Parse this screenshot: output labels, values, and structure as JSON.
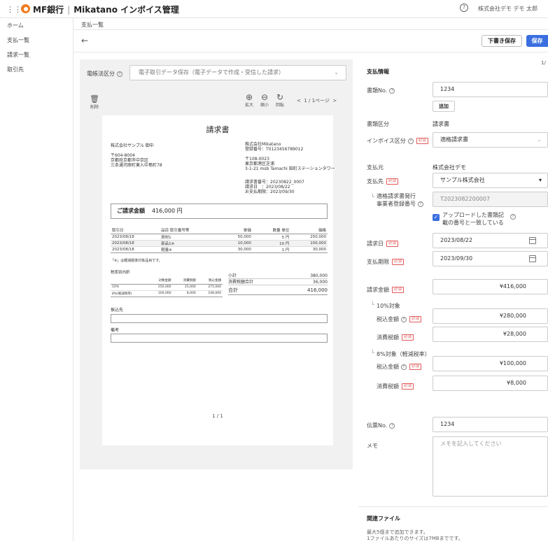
{
  "header": {
    "brand_bank": "MF銀行",
    "brand_app": "Mikatano インボイス管理",
    "help_icon_glyph": "?",
    "company_user": "株式会社デモ デモ 太郎",
    "accent_color": "#3b6fe0",
    "logo_color": "#ef7d22"
  },
  "sidebar": {
    "items": [
      {
        "label": "ホーム"
      },
      {
        "label": "支払一覧"
      },
      {
        "label": "請求一覧"
      },
      {
        "label": "取引先"
      }
    ]
  },
  "breadcrumb": "支払一覧",
  "toolbar": {
    "back_glyph": "←",
    "draft_label": "下書き保存",
    "save_label": "保存",
    "page_counter": "1/"
  },
  "viewer": {
    "law_label": "電帳法区分",
    "law_value": "電子取引データ保存（電子データで作成・受信した請求）",
    "delete_label": "削除",
    "zoom_in_label": "拡大",
    "zoom_out_label": "縮小",
    "rotate_label": "回転",
    "pager_text": "1 / 1ページ",
    "page_footer": "1 / 1"
  },
  "invoice_doc": {
    "title": "請求書",
    "to_company": "株式会社サンプル 御中",
    "to_postal": "〒604-8004",
    "to_addr1": "京都府京都市中京区",
    "to_addr2": "三条通河原町東入中島町78",
    "from_company": "株式会社Mikatano",
    "from_regno": "登録番号：T0123456789012",
    "from_postal": "〒108-0023",
    "from_addr1": "東京都港区芝浦",
    "from_addr2": "3-1-21 msb Tamachi 田町ステーションタワー",
    "meta1": "請求書番号：20230822_0007",
    "meta2": "請求日　：2023/08/22",
    "meta3": "お支払期限：2023/09/30",
    "total_label": "ご請求金額",
    "total_value": "416,000 円",
    "head": [
      "取引日",
      "品目 取引番号等",
      "単価",
      "数量 単位",
      "価格"
    ],
    "rows": [
      [
        "2023/08/18",
        "資材1",
        "50,000",
        "5 円",
        "250,000"
      ],
      [
        "2023/08/18",
        "部品1※",
        "10,000",
        "10 円",
        "100,000"
      ],
      [
        "2023/08/18",
        "軽量※",
        "30,000",
        "1 円",
        "30,000"
      ]
    ],
    "note": "「※」は軽減税率対象品目です。",
    "tax_title": "税率別内訳",
    "tax_head": [
      "",
      "対象金額",
      "消費税額",
      "税込金額"
    ],
    "tax_rows": [
      [
        "10%",
        "250,000",
        "25,000",
        "275,000"
      ],
      [
        "8%(軽減税率)",
        "100,000",
        "8,000",
        "108,000"
      ]
    ],
    "subtotal_label": "小計",
    "subtotal_value": "380,000",
    "tax_total_label": "消費税額合計",
    "tax_total_value": "36,000",
    "grand_label": "合計",
    "grand_value": "416,000",
    "bank_label": "振込先",
    "remarks_label": "備考"
  },
  "form": {
    "section_title": "支払情報",
    "invoice_no_label": "書類No.",
    "invoice_no_value": "1234",
    "add_label": "追加",
    "doc_type_label": "書類区分",
    "doc_type_value": "請求書",
    "invoice_type_label": "インボイス区分",
    "invoice_type_value": "適格請求書",
    "required_label": "必須",
    "payer_label": "支払元",
    "payer_value": "株式会社デモ",
    "payee_label": "支払先",
    "payee_value": "サンプル株式会社",
    "regno_label1": "適格請求書発行",
    "regno_label2": "事業者登録番号",
    "regno_value": "T2023082200007",
    "match_text1": "アップロードした書類記",
    "match_text2": "載の番号と一致している",
    "invoice_date_label": "請求日",
    "invoice_date_value": "2023/08/22",
    "due_date_label": "支払期限",
    "due_date_value": "2023/09/30",
    "amount_label": "請求金額",
    "amount_value": "¥416,000",
    "rate10_label": "10%対象",
    "incl_label": "税込金額",
    "tax_label": "消費税額",
    "rate10_incl": "¥280,000",
    "rate10_tax": "¥28,000",
    "rate8_label": "8%対象（軽減税率）",
    "rate8_incl": "¥100,000",
    "rate8_tax": "¥8,000",
    "slip_label": "伝票No.",
    "slip_value": "1234",
    "memo_label": "メモ",
    "memo_placeholder": "メモを記入してください",
    "files_title": "関連ファイル",
    "files_note1": "最大5個まで追加できます。",
    "files_note2": "1ファイルあたりのサイズは7MBまでです。"
  }
}
